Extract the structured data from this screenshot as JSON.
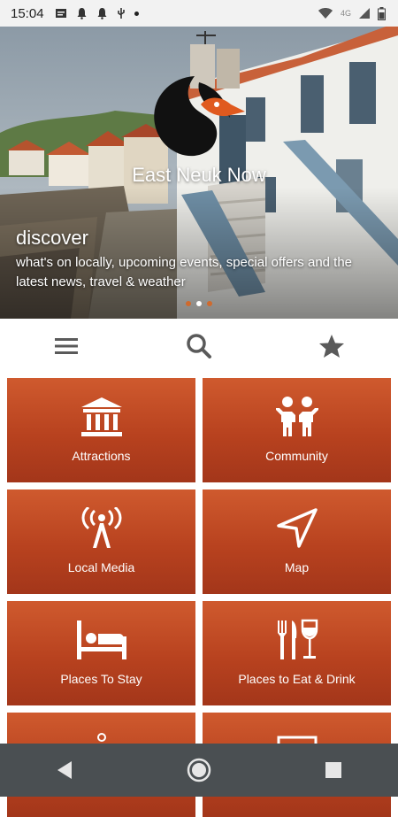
{
  "status_bar": {
    "time": "15:04",
    "network": "4G",
    "icons_left": [
      "message-icon",
      "bell-icon",
      "bell-icon",
      "usb-icon",
      "dot-icon"
    ],
    "icons_right": [
      "wifi-icon",
      "signal-icon",
      "battery-icon"
    ]
  },
  "hero": {
    "brand": "East Neuk Now",
    "heading": "discover",
    "description": "what's on locally, upcoming events, special offers and the latest news, travel & weather",
    "slides": 3,
    "active_slide": 2
  },
  "toolbar": {
    "items": [
      {
        "icon": "menu-icon"
      },
      {
        "icon": "search-icon"
      },
      {
        "icon": "star-icon"
      }
    ]
  },
  "tiles": [
    {
      "label": "Attractions",
      "icon": "museum-icon"
    },
    {
      "label": "Community",
      "icon": "people-icon"
    },
    {
      "label": "Local Media",
      "icon": "radio-tower-icon"
    },
    {
      "label": "Map",
      "icon": "navigation-arrow-icon"
    },
    {
      "label": "Places To Stay",
      "icon": "bed-icon"
    },
    {
      "label": "Places to Eat & Drink",
      "icon": "cutlery-glass-icon"
    }
  ],
  "colors": {
    "tile": "#b8421f",
    "accent": "#cf6a2e",
    "nav_bar": "#4a4f52"
  },
  "nav": {
    "items": [
      "back-icon",
      "home-icon",
      "recents-icon"
    ]
  }
}
